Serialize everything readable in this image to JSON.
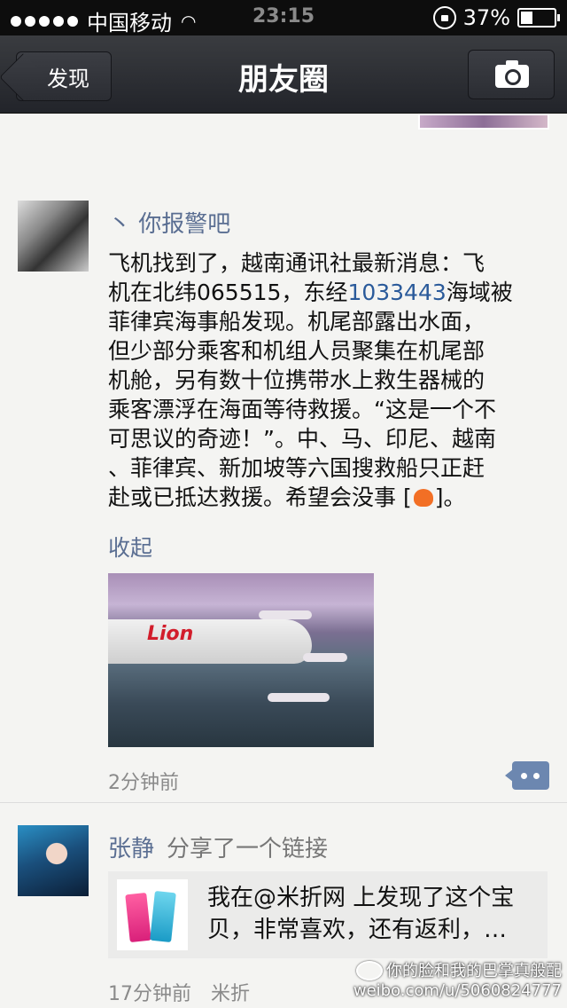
{
  "status_bar": {
    "carrier": "中国移动",
    "time": "23:15",
    "battery": "37%",
    "battery_level": 0.37
  },
  "nav": {
    "back_label": "发现",
    "title": "朋友圈",
    "camera_icon": "camera-icon"
  },
  "posts": [
    {
      "username": "丶 你报警吧",
      "text_lines": [
        "飞机找到了，越南通讯社最新消息：飞",
        "机在北纬065515，东经",
        "1033443",
        "海域被",
        "菲律宾海事船发现。机尾部露出水面，",
        "但少部分乘客和机组人员聚集在机尾部",
        "机舱，另有数十位携带水上救生器械的",
        "乘客漂浮在海面等待救援。“这是一个不",
        "可思议的奇迹！”。中、马、印尼、越南",
        "、菲律宾、新加坡等六国搜救船只正赶",
        "赴或已抵达救援。希望会没事 [",
        "]。"
      ],
      "collapse_label": "收起",
      "photo_text": "Lion",
      "time": "2分钟前"
    },
    {
      "username": "张静",
      "action": "分享了一个链接",
      "link_text": "我在@米折网 上发现了这个宝贝，非常喜欢，还有返利，…",
      "time": "17分钟前",
      "source": "米折"
    }
  ],
  "watermark": {
    "line1": "你的脸和我的巴掌真般配",
    "line2": "weibo.com/u/5060824777"
  }
}
